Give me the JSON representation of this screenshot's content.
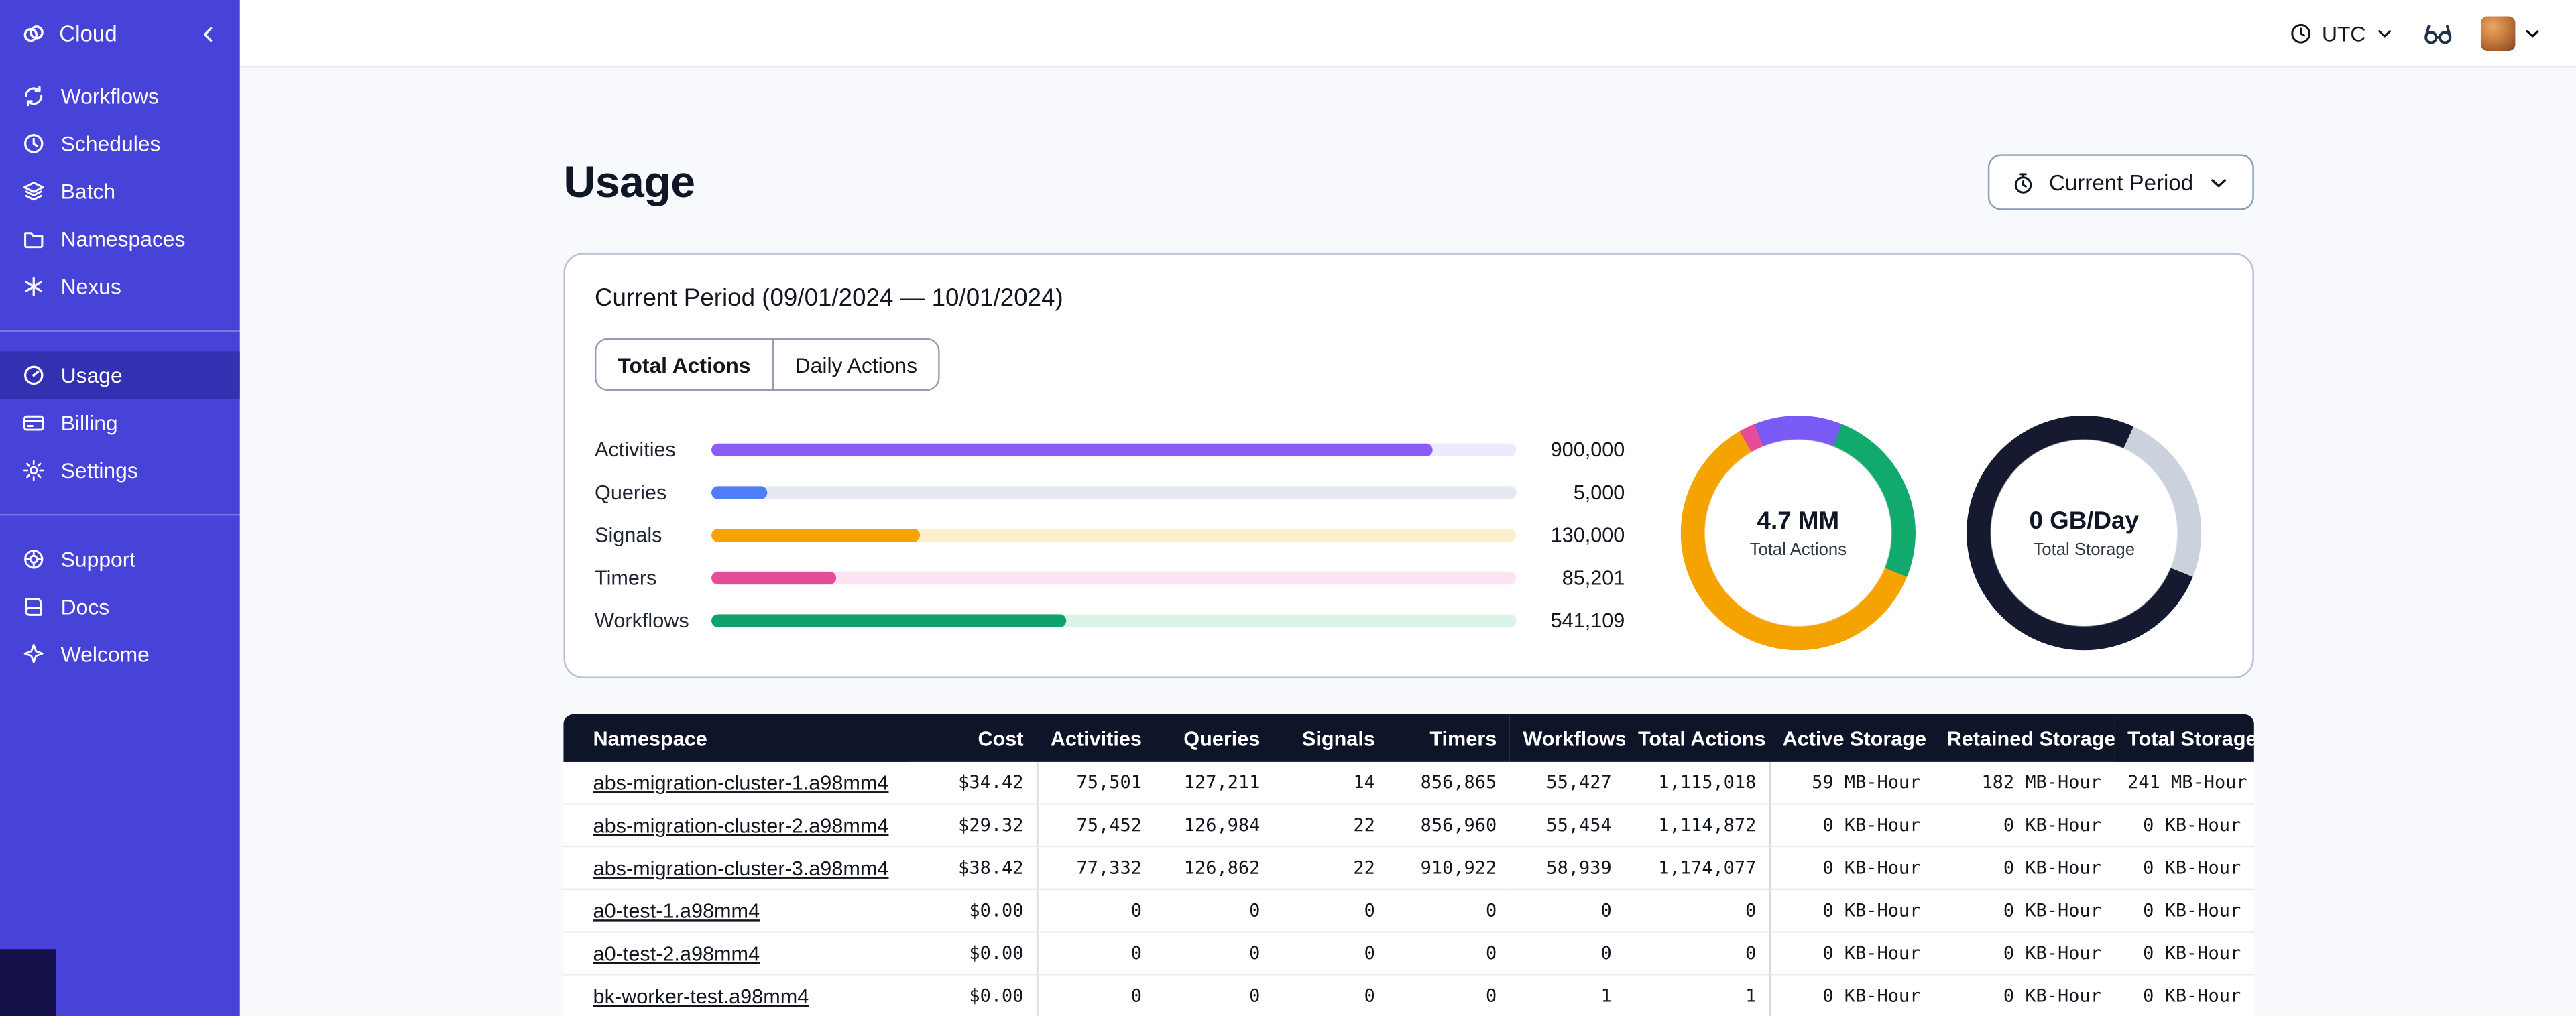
{
  "colors": {
    "sidebar": "#4743D8",
    "sidebar_active": "#3430B2",
    "table_header": "#0E1528",
    "page_bg": "#F8F9FC"
  },
  "sidebar": {
    "brand": "Cloud",
    "groups": [
      {
        "items": [
          {
            "name": "workflows",
            "label": "Workflows",
            "icon": "workflows-icon"
          },
          {
            "name": "schedules",
            "label": "Schedules",
            "icon": "schedules-icon"
          },
          {
            "name": "batch",
            "label": "Batch",
            "icon": "batch-icon"
          },
          {
            "name": "namespaces",
            "label": "Namespaces",
            "icon": "namespaces-icon"
          },
          {
            "name": "nexus",
            "label": "Nexus",
            "icon": "nexus-icon"
          }
        ]
      },
      {
        "items": [
          {
            "name": "usage",
            "label": "Usage",
            "icon": "usage-icon",
            "active": true
          },
          {
            "name": "billing",
            "label": "Billing",
            "icon": "billing-icon"
          },
          {
            "name": "settings",
            "label": "Settings",
            "icon": "settings-icon"
          }
        ]
      },
      {
        "items": [
          {
            "name": "support",
            "label": "Support",
            "icon": "support-icon"
          },
          {
            "name": "docs",
            "label": "Docs",
            "icon": "docs-icon"
          },
          {
            "name": "welcome",
            "label": "Welcome",
            "icon": "welcome-icon"
          }
        ]
      }
    ]
  },
  "topbar": {
    "timezone": "UTC"
  },
  "page": {
    "title": "Usage",
    "period_button_label": "Current Period"
  },
  "usage_card": {
    "title": "Current Period (09/01/2024 — 10/01/2024)",
    "tabs": [
      {
        "label": "Total Actions",
        "active": true
      },
      {
        "label": "Daily Actions",
        "active": false
      }
    ],
    "bars": [
      {
        "label": "Activities",
        "value": "900,000",
        "fraction": 0.895,
        "color": "#8B5CF6",
        "track": "#EDE9FE"
      },
      {
        "label": "Queries",
        "value": "5,000",
        "fraction": 0.07,
        "color": "#4F7DF9",
        "track": "#E4E9F2"
      },
      {
        "label": "Signals",
        "value": "130,000",
        "fraction": 0.26,
        "color": "#F5A300",
        "track": "#FDF0CD"
      },
      {
        "label": "Timers",
        "value": "85,201",
        "fraction": 0.155,
        "color": "#E54D9B",
        "track": "#FCE3F1"
      },
      {
        "label": "Workflows",
        "value": "541,109",
        "fraction": 0.44,
        "color": "#0FA36B",
        "track": "#D9F5E7"
      }
    ],
    "donuts": [
      {
        "value": "4.7 MM",
        "label": "Total Actions",
        "conic_stops": [
          [
            "#7B5BF5",
            0,
            22
          ],
          [
            "#12A96C",
            22,
            112
          ],
          [
            "#F5A300",
            112,
            330
          ],
          [
            "#E54D9B",
            330,
            338
          ],
          [
            "#7B5BF5",
            338,
            360
          ]
        ]
      },
      {
        "value": "0 GB/Day",
        "label": "Total Storage",
        "conic_stops": [
          [
            "#151A31",
            0,
            25
          ],
          [
            "#CCD2DD",
            25,
            112
          ],
          [
            "#151A31",
            112,
            360
          ]
        ]
      }
    ]
  },
  "table": {
    "columns": [
      "Namespace",
      "Cost",
      "Activities",
      "Queries",
      "Signals",
      "Timers",
      "Workflows",
      "Total Actions",
      "Active Storage",
      "Retained Storage",
      "Total Storage"
    ],
    "rows": [
      [
        "abs-migration-cluster-1.a98mm4",
        "$34.42",
        "75,501",
        "127,211",
        "14",
        "856,865",
        "55,427",
        "1,115,018",
        "59 MB-Hour",
        "182 MB-Hour",
        "241 MB-Hour"
      ],
      [
        "abs-migration-cluster-2.a98mm4",
        "$29.32",
        "75,452",
        "126,984",
        "22",
        "856,960",
        "55,454",
        "1,114,872",
        "0 KB-Hour",
        "0 KB-Hour",
        "0 KB-Hour"
      ],
      [
        "abs-migration-cluster-3.a98mm4",
        "$38.42",
        "77,332",
        "126,862",
        "22",
        "910,922",
        "58,939",
        "1,174,077",
        "0 KB-Hour",
        "0 KB-Hour",
        "0 KB-Hour"
      ],
      [
        "a0-test-1.a98mm4",
        "$0.00",
        "0",
        "0",
        "0",
        "0",
        "0",
        "0",
        "0 KB-Hour",
        "0 KB-Hour",
        "0 KB-Hour"
      ],
      [
        "a0-test-2.a98mm4",
        "$0.00",
        "0",
        "0",
        "0",
        "0",
        "0",
        "0",
        "0 KB-Hour",
        "0 KB-Hour",
        "0 KB-Hour"
      ],
      [
        "bk-worker-test.a98mm4",
        "$0.00",
        "0",
        "0",
        "0",
        "0",
        "1",
        "1",
        "0 KB-Hour",
        "0 KB-Hour",
        "0 KB-Hour"
      ]
    ]
  }
}
